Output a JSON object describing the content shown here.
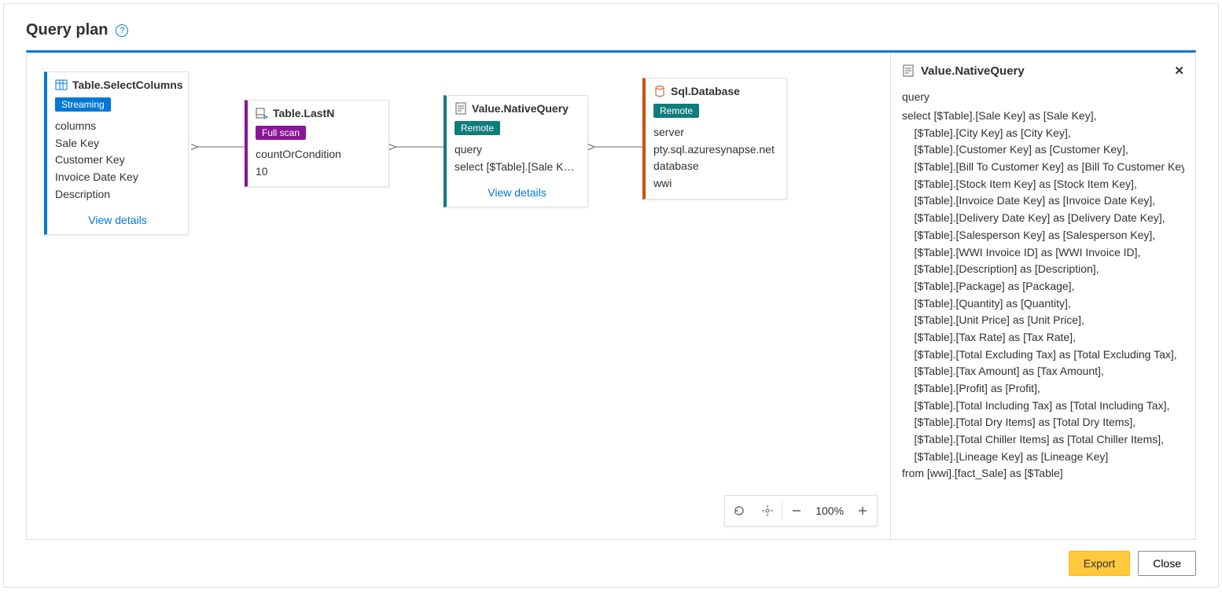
{
  "title": "Query plan",
  "nodes": {
    "n1": {
      "title": "Table.SelectColumns",
      "badge": "Streaming",
      "label": "columns",
      "v1": "Sale Key",
      "v2": "Customer Key",
      "v3": "Invoice Date Key",
      "v4": "Description",
      "link": "View details"
    },
    "n2": {
      "title": "Table.LastN",
      "badge": "Full scan",
      "label": "countOrCondition",
      "v1": "10"
    },
    "n3": {
      "title": "Value.NativeQuery",
      "badge": "Remote",
      "label": "query",
      "v1": "select [$Table].[Sale Ke…",
      "link": "View details"
    },
    "n4": {
      "title": "Sql.Database",
      "badge": "Remote",
      "label1": "server",
      "v1": "pty.sql.azuresynapse.net",
      "label2": "database",
      "v2": "wwi"
    }
  },
  "toolbar": {
    "zoom": "100%"
  },
  "detail": {
    "title": "Value.NativeQuery",
    "label": "query",
    "sql": "select [$Table].[Sale Key] as [Sale Key],\n    [$Table].[City Key] as [City Key],\n    [$Table].[Customer Key] as [Customer Key],\n    [$Table].[Bill To Customer Key] as [Bill To Customer Key],\n    [$Table].[Stock Item Key] as [Stock Item Key],\n    [$Table].[Invoice Date Key] as [Invoice Date Key],\n    [$Table].[Delivery Date Key] as [Delivery Date Key],\n    [$Table].[Salesperson Key] as [Salesperson Key],\n    [$Table].[WWI Invoice ID] as [WWI Invoice ID],\n    [$Table].[Description] as [Description],\n    [$Table].[Package] as [Package],\n    [$Table].[Quantity] as [Quantity],\n    [$Table].[Unit Price] as [Unit Price],\n    [$Table].[Tax Rate] as [Tax Rate],\n    [$Table].[Total Excluding Tax] as [Total Excluding Tax],\n    [$Table].[Tax Amount] as [Tax Amount],\n    [$Table].[Profit] as [Profit],\n    [$Table].[Total Including Tax] as [Total Including Tax],\n    [$Table].[Total Dry Items] as [Total Dry Items],\n    [$Table].[Total Chiller Items] as [Total Chiller Items],\n    [$Table].[Lineage Key] as [Lineage Key]\nfrom [wwi].[fact_Sale] as [$Table]"
  },
  "footer": {
    "export": "Export",
    "close": "Close"
  }
}
